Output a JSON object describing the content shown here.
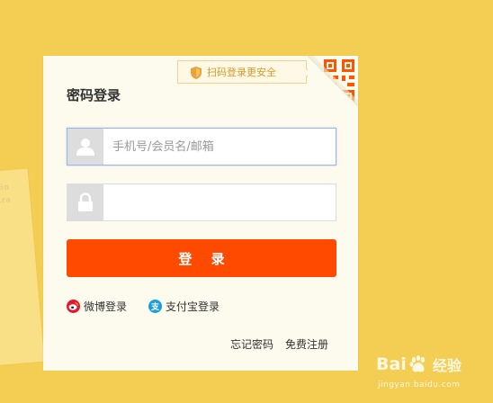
{
  "background_card": {
    "lines": [
      "sión",
      "ntra"
    ]
  },
  "login": {
    "title": "密码登录",
    "qr_tip": "扫码登录更安全",
    "username_placeholder": "手机号/会员名/邮箱",
    "password_placeholder": "",
    "submit_label": "登 录",
    "weibo_label": "微博登录",
    "alipay_label": "支付宝登录",
    "alipay_glyph": "支",
    "forgot_password": "忘记密码",
    "register": "免费注册"
  },
  "watermark": {
    "brand_left": "Bai",
    "brand_right": "经验",
    "url": "jingyan.baidu.com"
  },
  "colors": {
    "page_background": "#f4ce52",
    "panel": "#fdfaee",
    "login_button": "#ff4a00",
    "qr_orange": "#ff5500",
    "weibo": "#e6162d",
    "alipay": "#1a9fe0"
  },
  "icons": {
    "user": "user-icon",
    "lock": "lock-icon",
    "shield": "shield-icon",
    "qr": "qr-code-icon",
    "weibo": "weibo-icon",
    "alipay": "alipay-icon"
  }
}
